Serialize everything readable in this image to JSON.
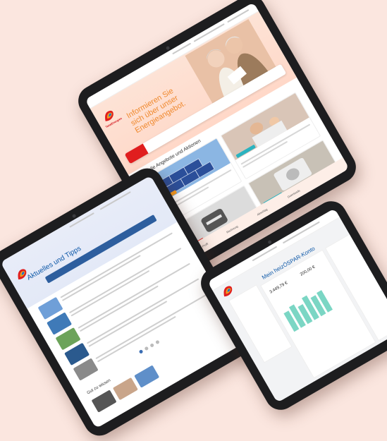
{
  "tablet1": {
    "hero_title": "Informieren Sie sich über unser Energieangebot.",
    "section_title": "Aktuelle Angebote und Aktionen",
    "footer_links": [
      "Profil",
      "Rechnung",
      "Abschlag",
      "Downloads"
    ],
    "brand": "TotalEnergies"
  },
  "tablet2": {
    "title": "Aktuelles und Tipps",
    "section_title": "Gut zu wissen"
  },
  "tablet3": {
    "title": "Mein heizÖSPAR-Konto",
    "stat1": "3.449,79 €",
    "stat2": "200,00 €"
  }
}
